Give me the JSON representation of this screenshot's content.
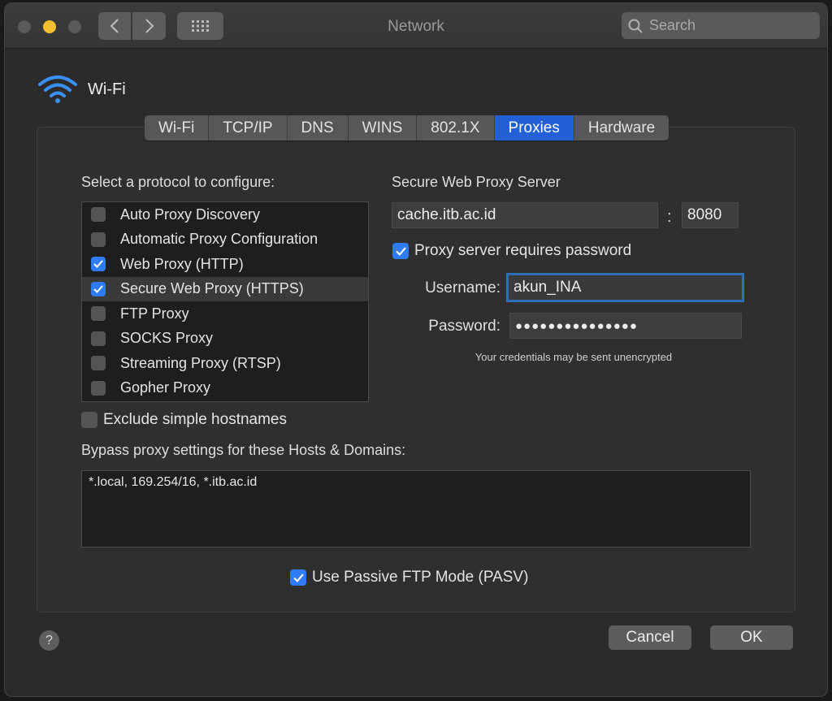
{
  "window": {
    "title": "Network"
  },
  "search": {
    "placeholder": "Search"
  },
  "interface": {
    "name": "Wi-Fi"
  },
  "tabs": [
    {
      "label": "Wi-Fi"
    },
    {
      "label": "TCP/IP"
    },
    {
      "label": "DNS"
    },
    {
      "label": "WINS"
    },
    {
      "label": "802.1X"
    },
    {
      "label": "Proxies"
    },
    {
      "label": "Hardware"
    }
  ],
  "protocols": {
    "heading": "Select a protocol to configure:",
    "items": [
      {
        "label": "Auto Proxy Discovery",
        "checked": false
      },
      {
        "label": "Automatic Proxy Configuration",
        "checked": false
      },
      {
        "label": "Web Proxy (HTTP)",
        "checked": true
      },
      {
        "label": "Secure Web Proxy (HTTPS)",
        "checked": true
      },
      {
        "label": "FTP Proxy",
        "checked": false
      },
      {
        "label": "SOCKS Proxy",
        "checked": false
      },
      {
        "label": "Streaming Proxy (RTSP)",
        "checked": false
      },
      {
        "label": "Gopher Proxy",
        "checked": false
      }
    ]
  },
  "proxy_server": {
    "heading": "Secure Web Proxy Server",
    "host": "cache.itb.ac.id",
    "colon": ":",
    "port": "8080",
    "requires_password_label": "Proxy server requires password",
    "username_label": "Username:",
    "username": "akun_INA",
    "password_label": "Password:",
    "password_mask": "●●●●●●●●●●●●●●●",
    "note": "Your credentials may be sent unencrypted"
  },
  "exclude_simple_hostnames": {
    "label": "Exclude simple hostnames"
  },
  "bypass": {
    "heading": "Bypass proxy settings for these Hosts & Domains:",
    "value": "*.local, 169.254/16, *.itb.ac.id"
  },
  "passive_ftp": {
    "label": "Use Passive FTP Mode (PASV)"
  },
  "buttons": {
    "help": "?",
    "cancel": "Cancel",
    "ok": "OK"
  },
  "colors": {
    "accent": "#2360d6",
    "checkbox": "#2f7cf6",
    "focus_ring": "#2f6fb8"
  }
}
